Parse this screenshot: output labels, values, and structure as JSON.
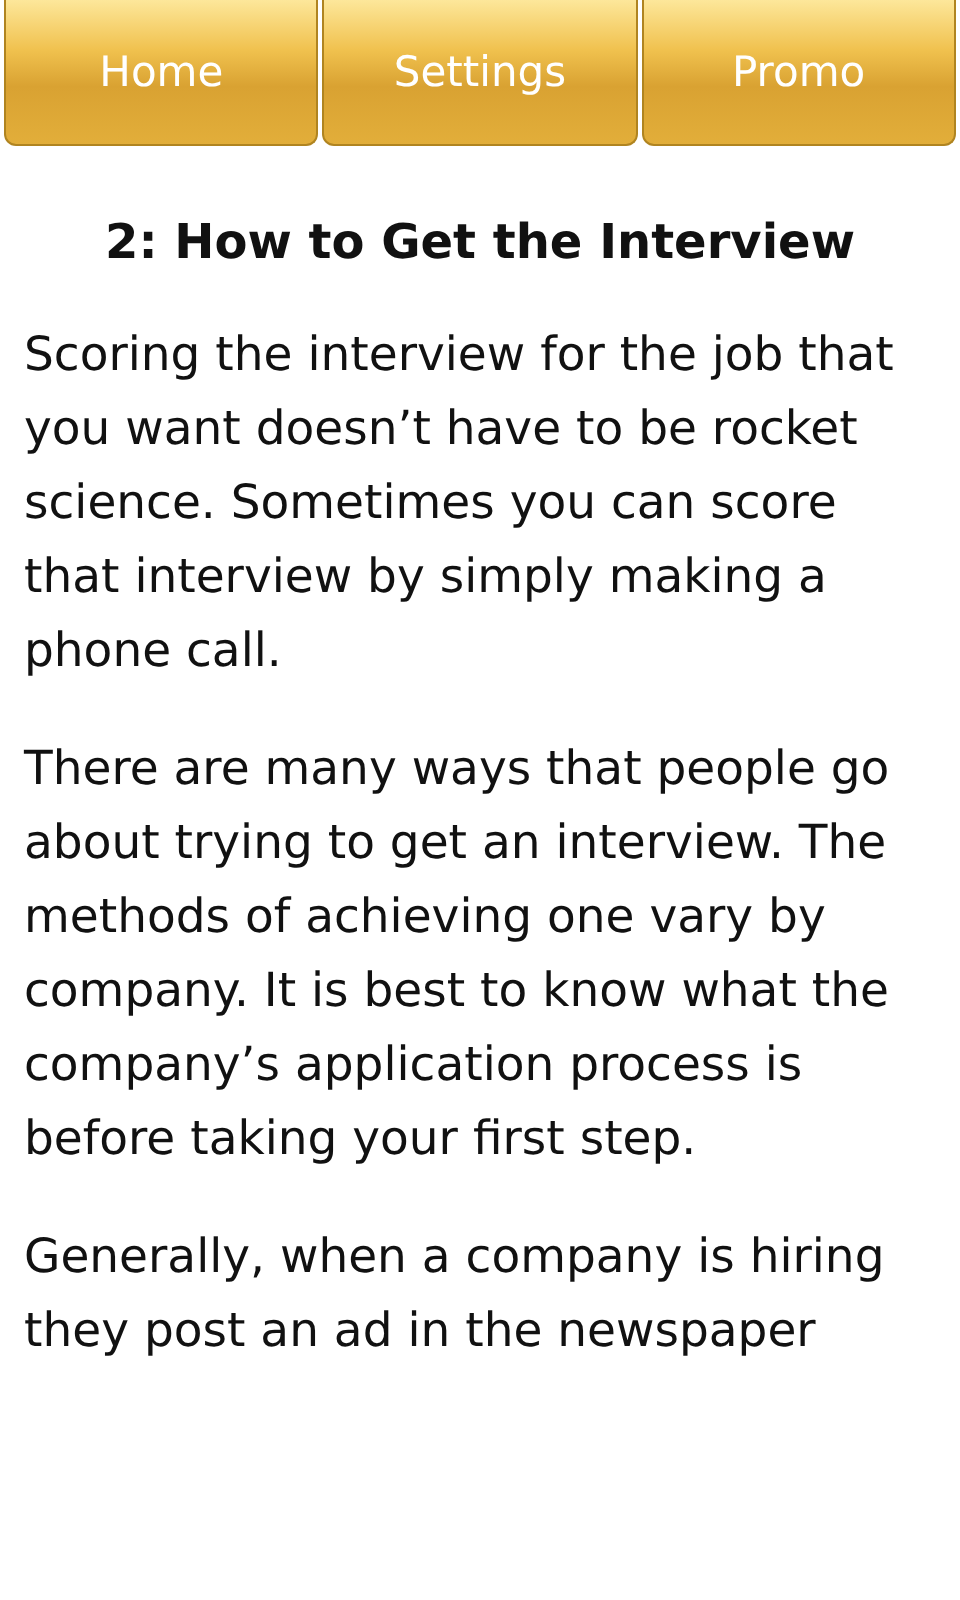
{
  "tabs": [
    {
      "label": "Home"
    },
    {
      "label": "Settings"
    },
    {
      "label": "Promo"
    }
  ],
  "article": {
    "title": "2: How to Get the Interview",
    "paragraphs": [
      "Scoring the interview for the job that you want doesn’t have to be rocket science. Sometimes you can score that interview by simply making a phone call.",
      "There are many ways that people go about trying to get an interview. The methods of achieving one vary by company. It is best to know what the company’s application process is before taking your first step.",
      "Generally, when a company is hiring they post an ad in the newspaper"
    ]
  }
}
